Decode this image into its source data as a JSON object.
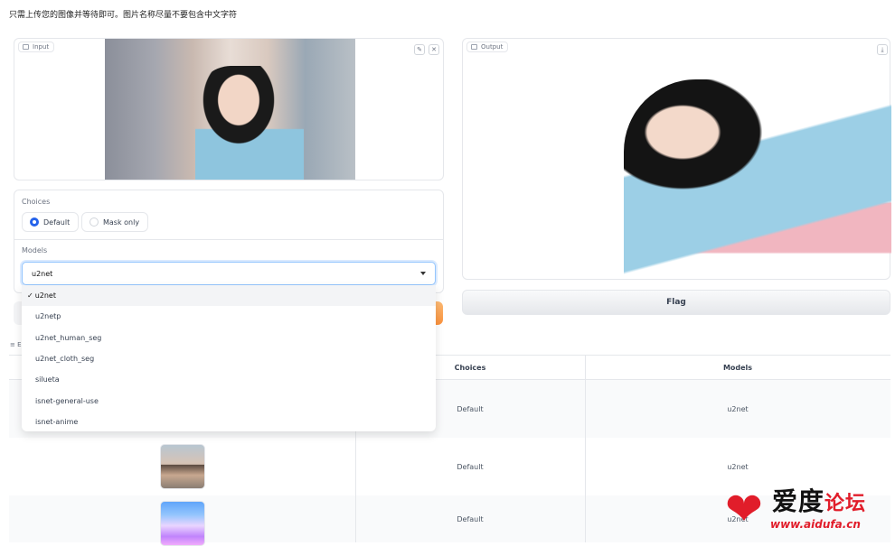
{
  "instruction": "只需上传您的图像并等待即可。图片名称尽量不要包含中文字符",
  "input": {
    "label": "Input"
  },
  "output": {
    "label": "Output"
  },
  "choices": {
    "label": "Choices",
    "options": [
      "Default",
      "Mask only"
    ],
    "selected": "Default"
  },
  "models": {
    "label": "Models",
    "selected": "u2net",
    "options": [
      "u2net",
      "u2netp",
      "u2net_human_seg",
      "u2net_cloth_seg",
      "silueta",
      "isnet-general-use",
      "isnet-anime"
    ]
  },
  "flag_label": "Flag",
  "examples": {
    "label": "≡ E",
    "headers": [
      "",
      "Choices",
      "Models"
    ],
    "rows": [
      {
        "choice": "Default",
        "model": "u2net"
      },
      {
        "choice": "Default",
        "model": "u2net"
      },
      {
        "choice": "Default",
        "model": "u2net"
      }
    ]
  },
  "watermark": {
    "text_main": "爱度",
    "text_red": "论坛",
    "url": "www.aidufa.cn"
  },
  "colors": {
    "accent": "#2563eb",
    "watermark_red": "#e11d2a",
    "submit_orange": "#fb923c"
  }
}
